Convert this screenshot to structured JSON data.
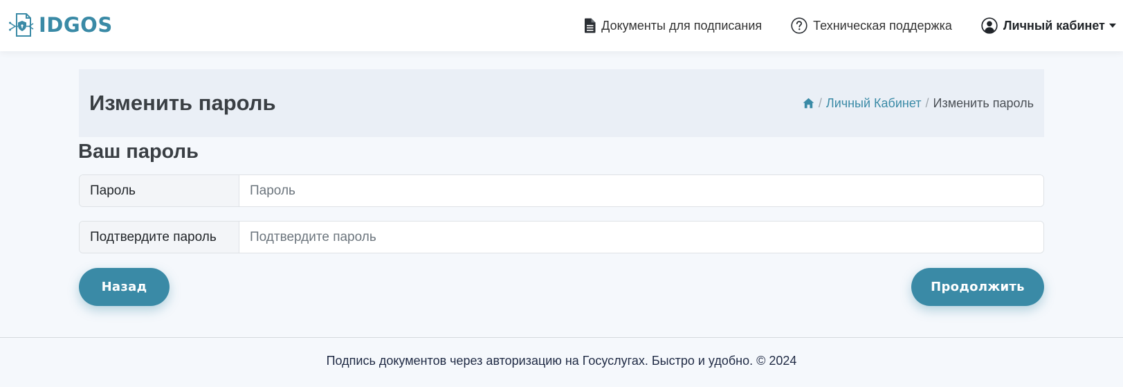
{
  "brand": {
    "name": "IDGOS"
  },
  "nav": {
    "documents": "Документы для подписания",
    "support": "Техническая поддержка",
    "account": "Личный кабинет"
  },
  "page": {
    "title": "Изменить пароль",
    "breadcrumb": {
      "account": "Личный Кабинет",
      "current": "Изменить пароль"
    }
  },
  "form": {
    "section_title": "Ваш пароль",
    "password": {
      "label": "Пароль",
      "value": "",
      "placeholder": "Пароль"
    },
    "confirm": {
      "label": "Подтвердите пароль",
      "value": "",
      "placeholder": "Подтвердите пароль"
    },
    "back_label": "Назад",
    "continue_label": "Продолжить"
  },
  "footer": {
    "text": "Подпись документов через авторизацию на Госуслугах. Быстро и удобно. © 2024"
  },
  "colors": {
    "accent": "#3a8aa6",
    "header_panel": "#eaeff6",
    "background": "#f5f8fc"
  }
}
